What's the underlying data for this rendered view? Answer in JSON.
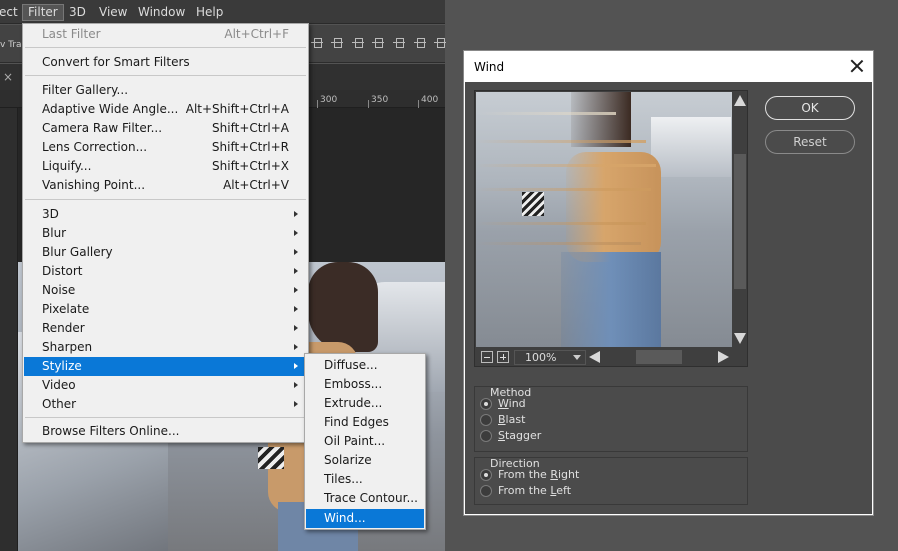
{
  "menubar": {
    "items": [
      {
        "label": "ect",
        "active": false
      },
      {
        "label": "Filter",
        "active": true
      },
      {
        "label": "3D",
        "active": false
      },
      {
        "label": "View",
        "active": false
      },
      {
        "label": "Window",
        "active": false
      },
      {
        "label": "Help",
        "active": false
      }
    ]
  },
  "options_bar": {
    "partial_text": "v Tra"
  },
  "ruler": {
    "labels": [
      "300",
      "350",
      "400"
    ]
  },
  "filter_menu": {
    "items": [
      {
        "label": "Last Filter",
        "shortcut": "Alt+Ctrl+F",
        "disabled": true
      },
      {
        "label": "Convert for Smart Filters"
      },
      {
        "label": "Filter Gallery..."
      },
      {
        "label": "Adaptive Wide Angle...",
        "shortcut": "Alt+Shift+Ctrl+A"
      },
      {
        "label": "Camera Raw Filter...",
        "shortcut": "Shift+Ctrl+A"
      },
      {
        "label": "Lens Correction...",
        "shortcut": "Shift+Ctrl+R"
      },
      {
        "label": "Liquify...",
        "shortcut": "Shift+Ctrl+X"
      },
      {
        "label": "Vanishing Point...",
        "shortcut": "Alt+Ctrl+V"
      },
      {
        "label": "3D",
        "submenu": true
      },
      {
        "label": "Blur",
        "submenu": true
      },
      {
        "label": "Blur Gallery",
        "submenu": true
      },
      {
        "label": "Distort",
        "submenu": true
      },
      {
        "label": "Noise",
        "submenu": true
      },
      {
        "label": "Pixelate",
        "submenu": true
      },
      {
        "label": "Render",
        "submenu": true
      },
      {
        "label": "Sharpen",
        "submenu": true
      },
      {
        "label": "Stylize",
        "submenu": true,
        "highlighted": true
      },
      {
        "label": "Video",
        "submenu": true
      },
      {
        "label": "Other",
        "submenu": true
      },
      {
        "label": "Browse Filters Online..."
      }
    ]
  },
  "stylize_menu": {
    "items": [
      {
        "label": "Diffuse..."
      },
      {
        "label": "Emboss..."
      },
      {
        "label": "Extrude..."
      },
      {
        "label": "Find Edges"
      },
      {
        "label": "Oil Paint..."
      },
      {
        "label": "Solarize"
      },
      {
        "label": "Tiles..."
      },
      {
        "label": "Trace Contour..."
      },
      {
        "label": "Wind...",
        "highlighted": true
      }
    ]
  },
  "wind_dialog": {
    "title": "Wind",
    "ok_label": "OK",
    "reset_label": "Reset",
    "zoom": "100%",
    "method": {
      "legend": "Method",
      "options": [
        {
          "label": "Wind",
          "mnemonic": "W",
          "rest": "ind",
          "selected": true
        },
        {
          "label": "Blast",
          "mnemonic": "B",
          "rest": "last",
          "selected": false
        },
        {
          "label": "Stagger",
          "mnemonic": "S",
          "rest": "tagger",
          "selected": false
        }
      ]
    },
    "direction": {
      "legend": "Direction",
      "options": [
        {
          "prefix": "From the ",
          "mnemonic": "R",
          "rest": "ight",
          "selected": true
        },
        {
          "prefix": "From the ",
          "mnemonic": "L",
          "rest": "eft",
          "selected": false
        }
      ]
    }
  },
  "colors": {
    "accent": "#0a78d7",
    "menu_bg": "#f0f0f0",
    "dialog_bg": "#4b4b4b",
    "app_bg": "#535353"
  },
  "icons": [
    "close-icon",
    "submenu-arrow-icon",
    "zoom-in-icon",
    "zoom-out-icon",
    "scroll-arrow-icon",
    "radio-icon"
  ]
}
